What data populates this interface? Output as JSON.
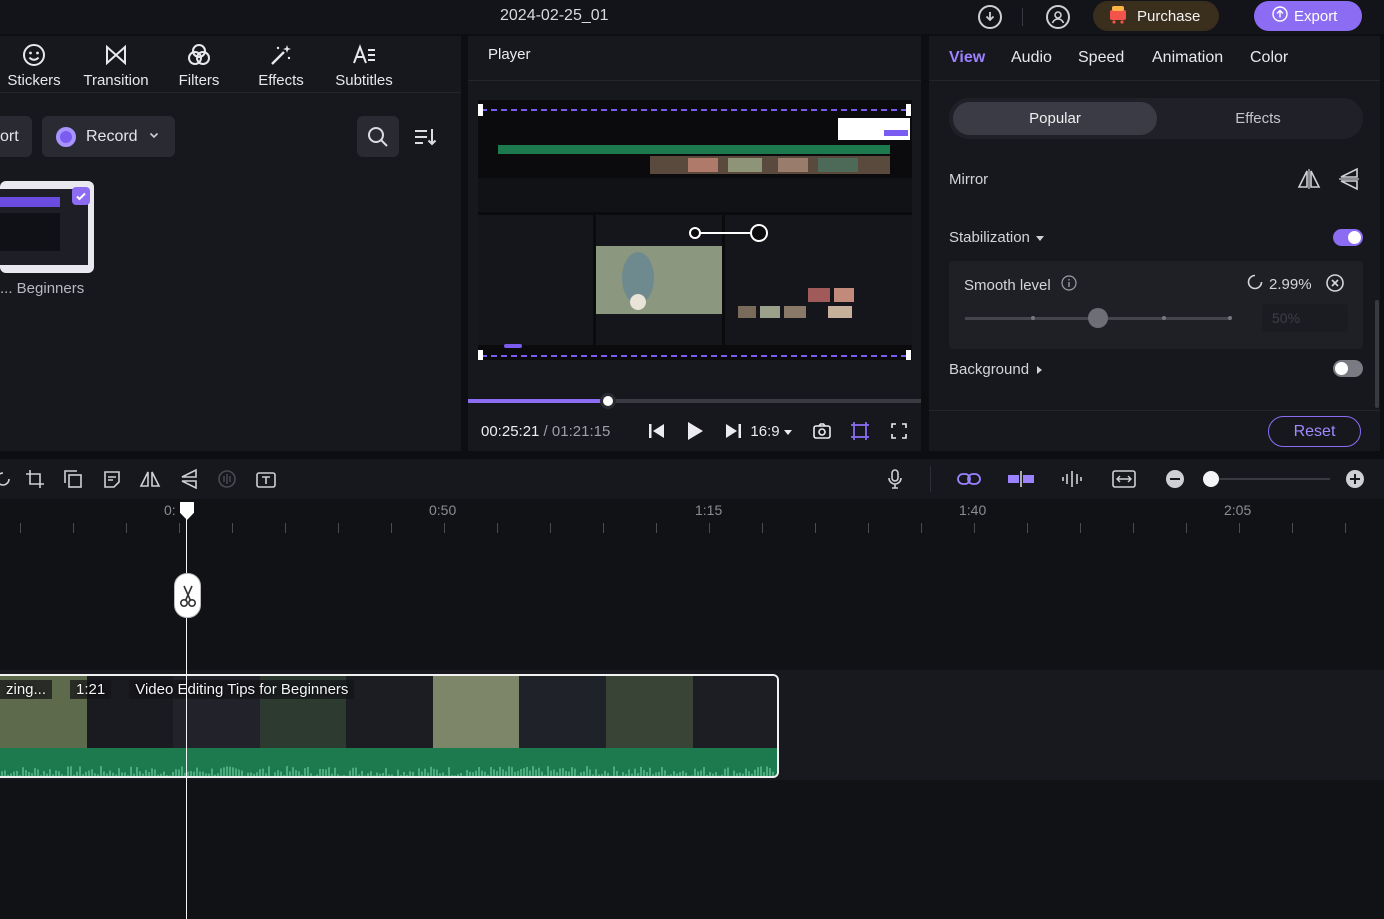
{
  "window": {
    "title": "2024-02-25_01"
  },
  "top_bar": {
    "purchase_label": "Purchase",
    "export_label": "Export"
  },
  "left_panel": {
    "tabs": [
      {
        "label": "Stickers",
        "icon": "sticker-icon"
      },
      {
        "label": "Transition",
        "icon": "transition-icon"
      },
      {
        "label": "Filters",
        "icon": "filters-icon"
      },
      {
        "label": "Effects",
        "icon": "effects-icon"
      },
      {
        "label": "Subtitles",
        "icon": "subtitles-icon"
      }
    ],
    "import_partial_label": "ort",
    "record_label": "Record",
    "media_item_label": "... Beginners"
  },
  "player": {
    "title": "Player",
    "current_time": "00:25:21",
    "separator": " / ",
    "total_time": "01:21:15",
    "aspect_ratio": "16:9",
    "progress_fraction": 0.31
  },
  "right_panel": {
    "tabs": [
      "View",
      "Audio",
      "Speed",
      "Animation",
      "Color"
    ],
    "active_tab": "View",
    "segments": {
      "active": "Popular",
      "inactive": "Effects"
    },
    "mirror_label": "Mirror",
    "stabilization_label": "Stabilization",
    "stabilization_on": true,
    "smooth_level_label": "Smooth level",
    "smooth_value": "2.99%",
    "smooth_input_placeholder": "50%",
    "smooth_slider_fraction": 0.5,
    "background_label": "Background",
    "background_on": false,
    "reset_label": "Reset"
  },
  "timeline": {
    "ruler_labels": [
      "0:",
      "0:50",
      "1:15",
      "1:40",
      "2:05"
    ],
    "clip": {
      "name_partial": "zing...",
      "duration": "1:21",
      "title": "Video Editing Tips for Beginners"
    },
    "zoom_fraction": 0.0
  },
  "colors": {
    "accent": "#8b6cf2",
    "audio_track": "#1c7a4e",
    "panel": "#17181d"
  }
}
